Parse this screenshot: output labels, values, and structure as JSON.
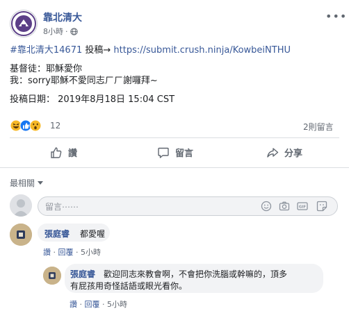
{
  "post": {
    "page_name": "靠北清大",
    "time": "8小時",
    "line1_tag": "#靠北清大14671",
    "line1_mid": " 投稿→ ",
    "line1_link": "https://submit.crush.ninja/KowbeiNTHU",
    "line2": "基督徒：耶穌愛你",
    "line3": "我：sorry耶穌不愛同志ㄏㄏ謝囉拜~",
    "line4": "投稿日期： 2019年8月18日 15:04 CST",
    "reaction_count": "12",
    "comment_count": "2則留言"
  },
  "actions": {
    "like": "讚",
    "comment": "留言",
    "share": "分享"
  },
  "sort_label": "最相關",
  "composer": {
    "placeholder": "留言⋯⋯"
  },
  "comments": [
    {
      "author": "張庭睿",
      "text": "都愛喔",
      "like": "讚",
      "reply": "回覆",
      "time": "5小時"
    },
    {
      "author": "張庭睿",
      "text_line1": "歡迎同志來教會啊，不會把你洗腦或幹嘛的，頂多",
      "text_line2": "有屁孩用奇怪話語或眼光看你。",
      "like": "讚",
      "reply": "回覆",
      "time": "5小時"
    }
  ],
  "colors": {
    "link": "#385898",
    "meta": "#606770",
    "divider": "#dadde1",
    "bubble": "#f2f3f5",
    "page_logo": "#5b3f87"
  }
}
